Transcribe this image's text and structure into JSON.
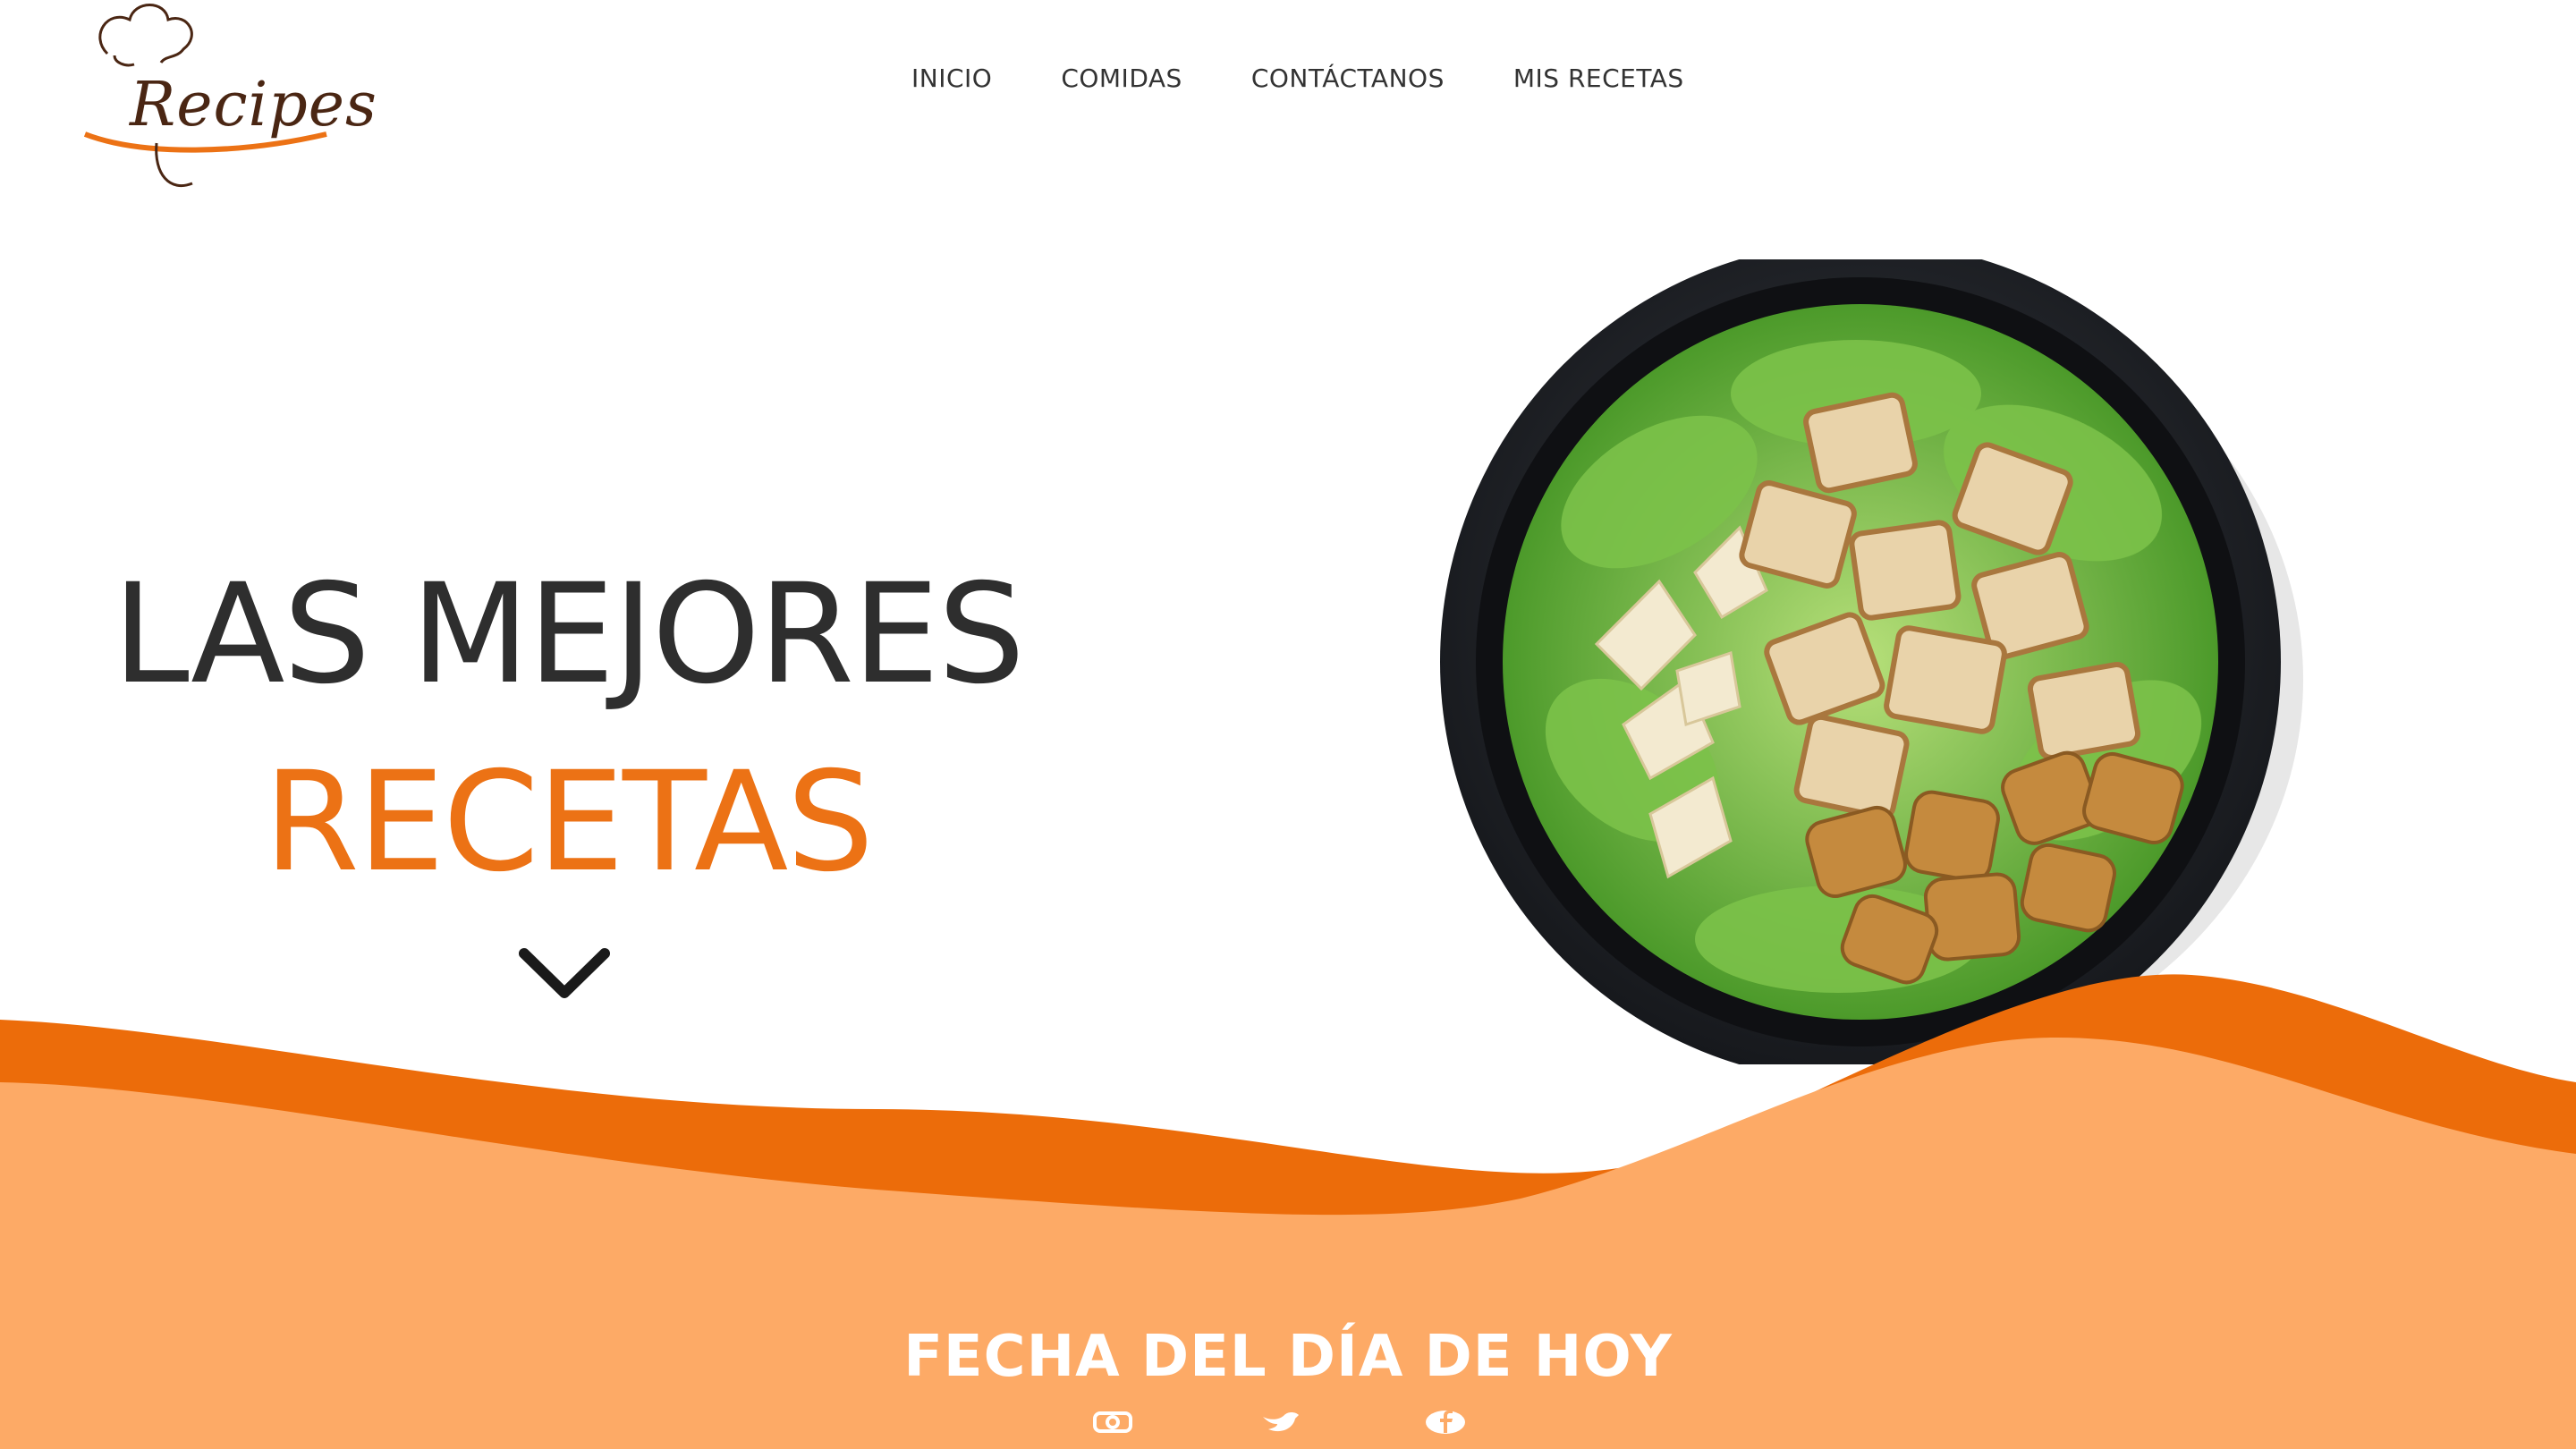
{
  "logo": {
    "text": "Recipes"
  },
  "nav": {
    "items": [
      {
        "label": "INICIO"
      },
      {
        "label": "COMIDAS"
      },
      {
        "label": "CONTÁCTANOS"
      },
      {
        "label": "MIS RECETAS"
      }
    ]
  },
  "hero": {
    "line1": "LAS MEJORES",
    "line2": "RECETAS",
    "scroll_icon": "chevron-down-icon",
    "image_alt": "salad-bowl"
  },
  "footer": {
    "title": "FECHA DEL DÍA DE HOY",
    "socials": [
      "instagram-icon",
      "twitter-icon",
      "facebook-icon"
    ]
  },
  "colors": {
    "accent": "#ec7215",
    "accent_light": "#fdaa66",
    "text_dark": "#2e2e2e",
    "logo_brown": "#4a2613"
  }
}
